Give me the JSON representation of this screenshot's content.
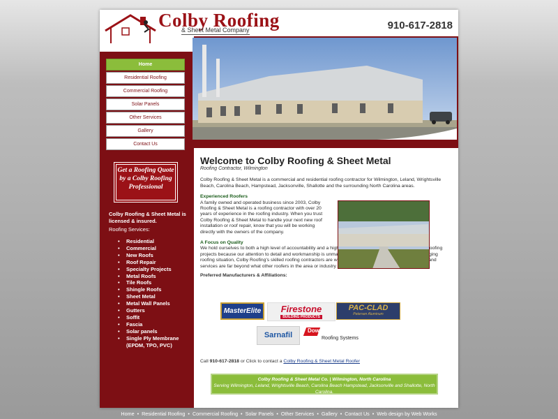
{
  "header": {
    "logo_title": "Colby Roofing",
    "logo_sub": "& Sheet Metal Company",
    "phone": "910-617-2818"
  },
  "nav": [
    {
      "label": "Home",
      "active": true
    },
    {
      "label": "Residential Roofing"
    },
    {
      "label": "Commercial Roofing"
    },
    {
      "label": "Solar Panels"
    },
    {
      "label": "Other Services"
    },
    {
      "label": "Gallery"
    },
    {
      "label": "Contact Us"
    }
  ],
  "sidebar": {
    "quote": "Get a Roofing Quote by a Colby Roofing Professional",
    "licensed": "Colby Roofing & Sheet Metal is licensed & insured.",
    "services_title": "Roofing Services:",
    "services": [
      "Residential",
      "Commercial",
      "New Roofs",
      "Roof Repair",
      "Specialty Projects",
      "Metal Roofs",
      "Tile Roofs",
      "Shingle Roofs",
      "Sheet Metal",
      "Metal Wall Panels",
      "Gutters",
      "Soffit",
      "Fascia",
      "Solar panels",
      "Single Ply Membrane (EPDM, TPO, PVC)"
    ]
  },
  "content": {
    "welcome": "Welcome to Colby Roofing & Sheet Metal",
    "subtitle": "Roofing Contractor, Wilmington",
    "intro": "Colby Roofing & Sheet Metal is a commercial and residential roofing contractor for Wilmington, Leland, Wrightsville Beach, Carolina Beach, Hampstead, Jacksonville, Shallotte and the surrounding North Carolina areas.",
    "exp_head": "Experienced Roofers",
    "exp_body": "A family owned and operated business since 2003, Colby Roofing & Sheet Metal is a roofing contractor with over 20 years of experience in the roofing industry. When you trust Colby Roofing & Sheet Metal to handle your next new roof installation or roof repair, know that you will be working directly with the owners of the company.",
    "quality_head": "A Focus on Quality",
    "quality_body": "We hold ourselves to both a high level of accountability and a high level of quality. We specialize in high-end roofing projects because our attention to detail and workmanship is unmatched. If you have a roofing need or challenging roofing situation, Colby Roofing's skilled roofing contractors are who you should call. Our products, materials and services are far beyond what other roofers in the area or industry are offering.",
    "partners_title": "Preferred Manufacturers & Affiliations:",
    "partners": [
      "MasterElite",
      "Firestone",
      "BUILDING PRODUCTS",
      "PAC-CLAD",
      "Petersen Aluminum",
      "Sarnafil",
      "Dow",
      "Roofing Systems"
    ],
    "call_prefix": "Call",
    "call_phone": "910-617-2818",
    "call_mid": "or Click to contact a",
    "call_link": "Colby Roofing & Sheet Metal Roofer",
    "footer_title": "Colby Roofing & Sheet Metal Co. | Wilmington, North Carolina",
    "footer_sub": "Serving Wilmington, Leland, Wrightsville Beach, Carolina Beach Hampstead, Jacksonville and Shallotte, North Carolina."
  },
  "bottom_nav": [
    "Home",
    "Residential Roofing",
    "Commercial Roofing",
    "Solar Panels",
    "Other Services",
    "Gallery",
    "Contact Us",
    "Web design by Web Works"
  ],
  "colors": {
    "brand_red": "#7d0f14",
    "accent_green": "#8bbd3b"
  }
}
